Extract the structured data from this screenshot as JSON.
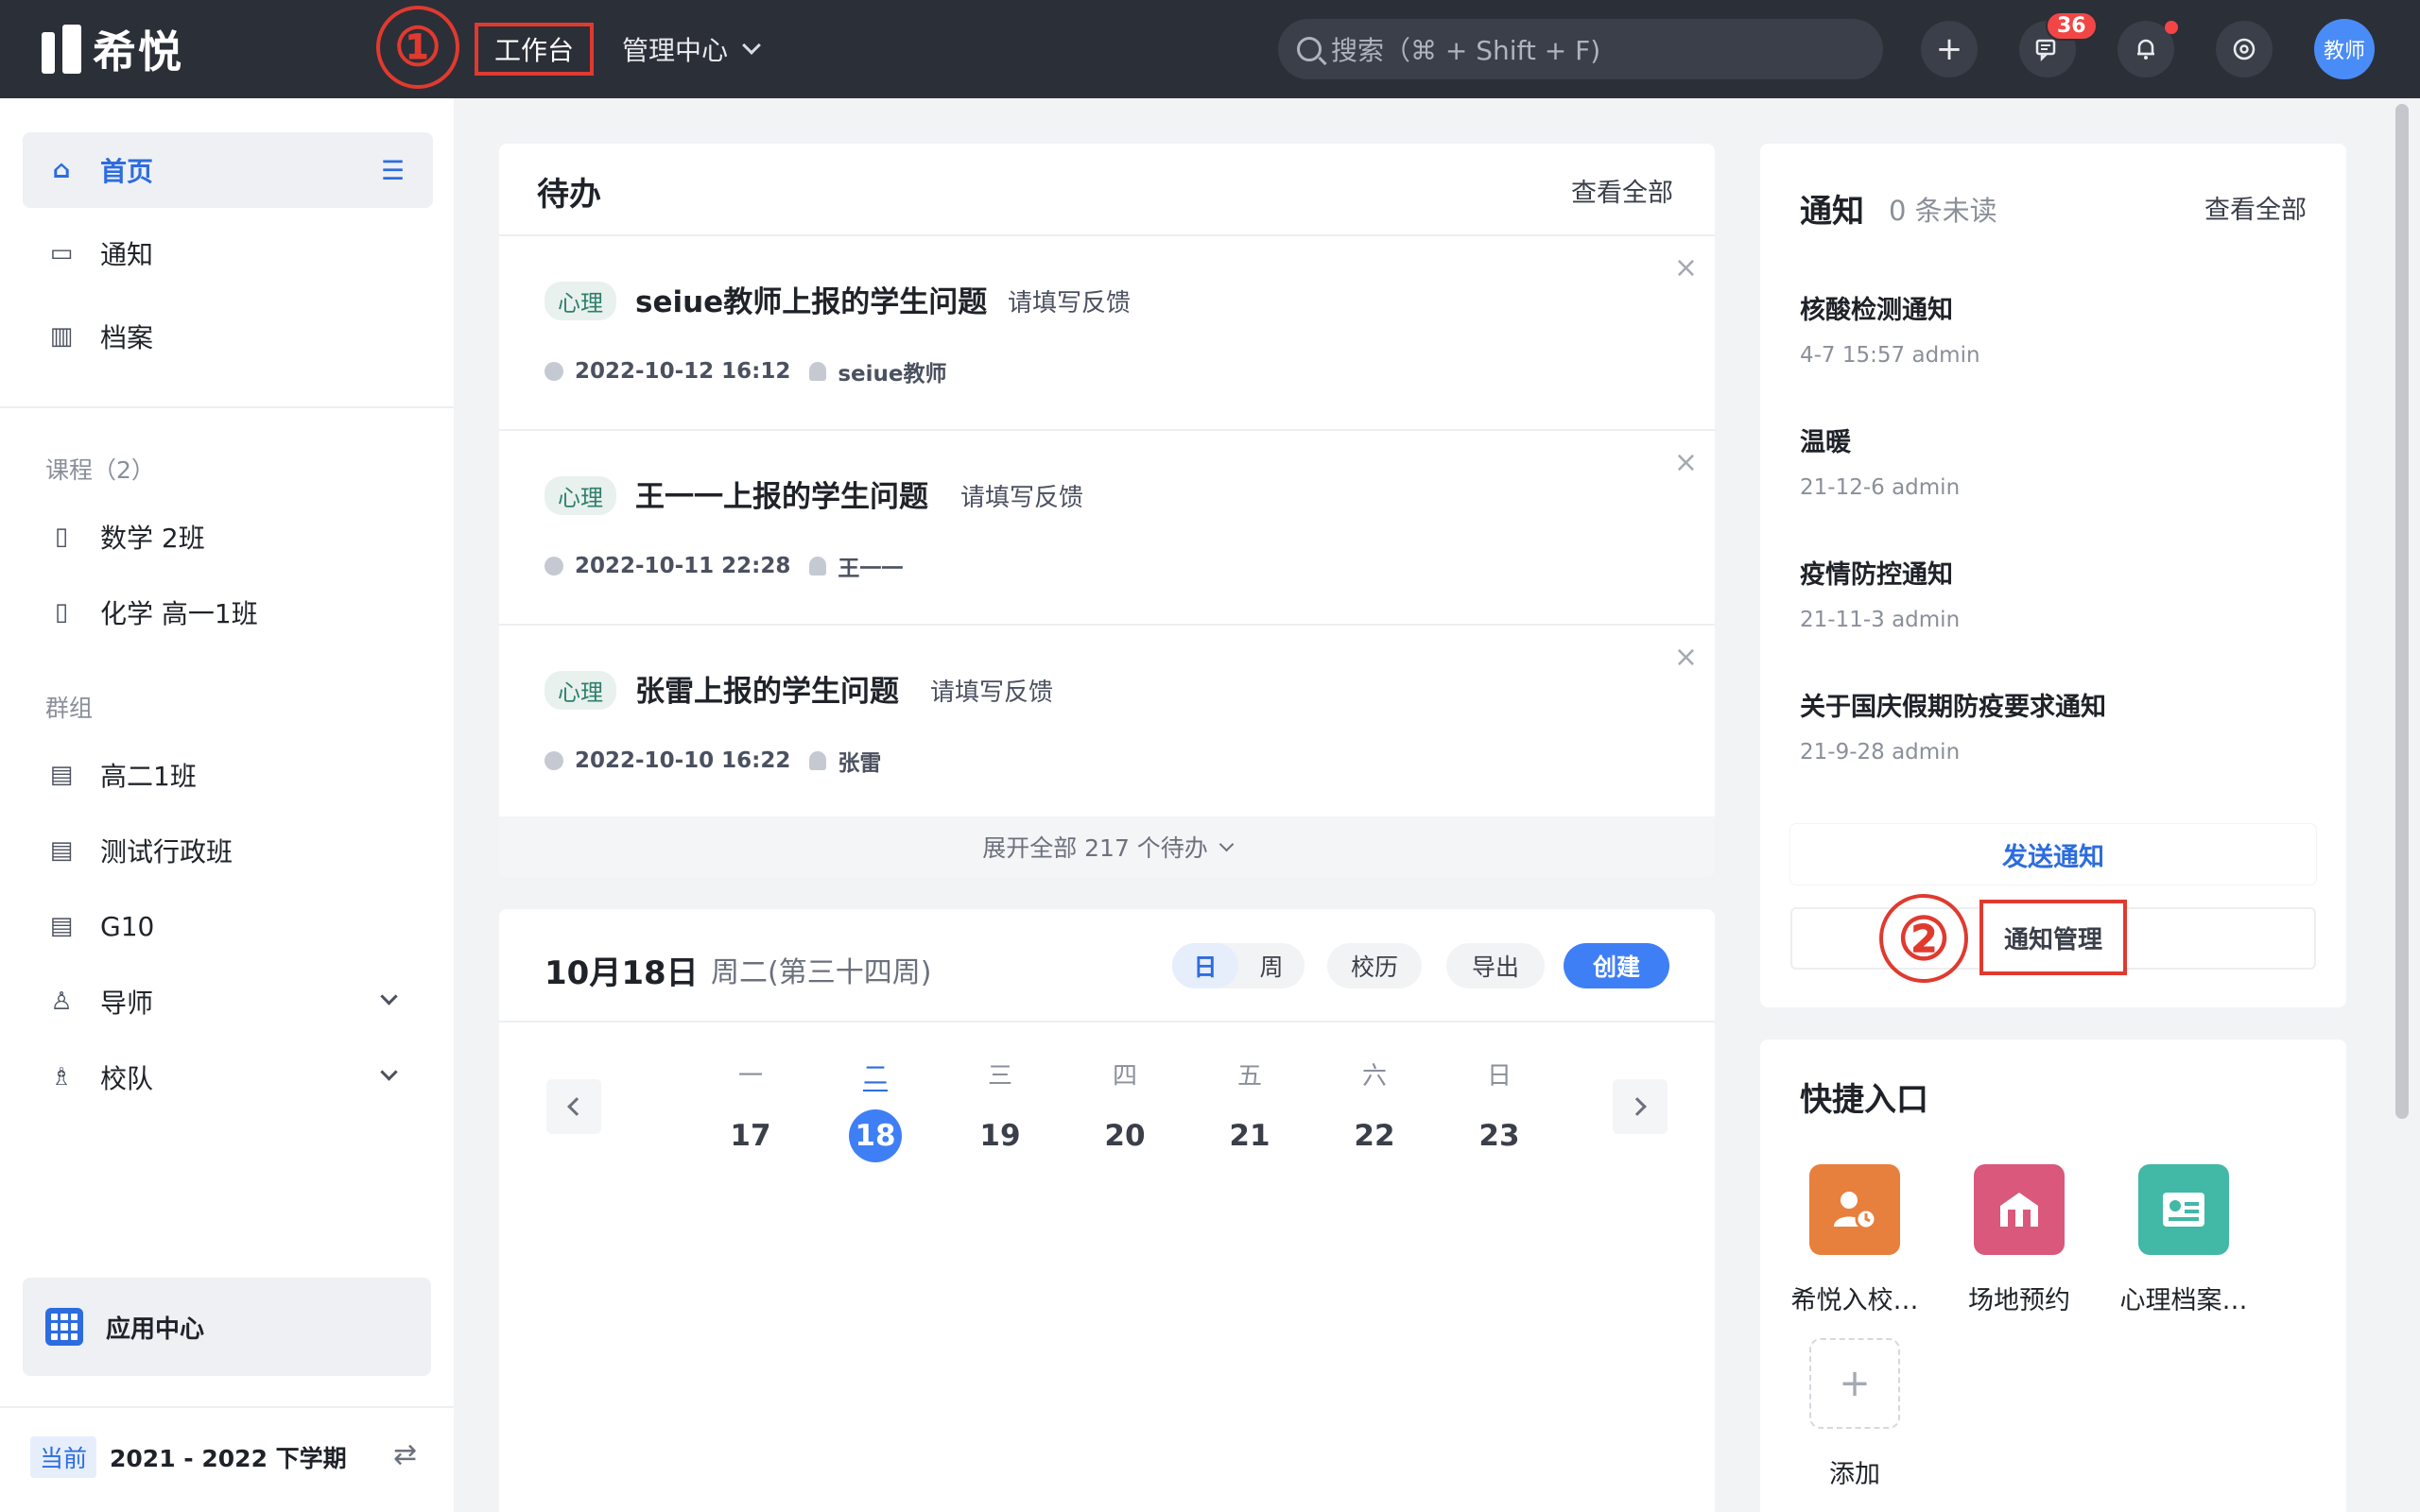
{
  "header": {
    "logo_text": "希悦",
    "step1": "①",
    "nav_workbench": "工作台",
    "nav_admin": "管理中心",
    "search_placeholder": "搜索（⌘ + Shift + F)",
    "message_badge": "36",
    "avatar_label": "教师",
    "icons": [
      "plus-icon",
      "message-icon",
      "bell-icon",
      "settings-icon"
    ]
  },
  "sidebar": {
    "home": "首页",
    "notice": "通知",
    "archive": "档案",
    "course_header": "课程（2）",
    "courses": [
      "数学 2班",
      "化学 高一1班"
    ],
    "group_header": "群组",
    "groups": [
      "高二1班",
      "测试行政班",
      "G10"
    ],
    "mentor": "导师",
    "team": "校队",
    "app_center": "应用中心",
    "term_current": "当前",
    "term_name": "2021 - 2022 下学期"
  },
  "todo": {
    "title": "待办",
    "view_all": "查看全部",
    "items": [
      {
        "tag": "心理",
        "title": "seiue教师上报的学生问题",
        "action": "请填写反馈",
        "time": "2022-10-12 16:12",
        "user": "seiue教师"
      },
      {
        "tag": "心理",
        "title": "王一一上报的学生问题",
        "action": "请填写反馈",
        "time": "2022-10-11 22:28",
        "user": "王一一"
      },
      {
        "tag": "心理",
        "title": "张雷上报的学生问题",
        "action": "请填写反馈",
        "time": "2022-10-10 16:22",
        "user": "张雷"
      }
    ],
    "expand": "展开全部 217 个待办"
  },
  "calendar": {
    "date": "10月18日",
    "week": "周二(第三十四周)",
    "seg_day": "日",
    "seg_week": "周",
    "school_calendar": "校历",
    "export": "导出",
    "create": "创建",
    "days": [
      {
        "wd": "一",
        "dn": "17"
      },
      {
        "wd": "二",
        "dn": "18"
      },
      {
        "wd": "三",
        "dn": "19"
      },
      {
        "wd": "四",
        "dn": "20"
      },
      {
        "wd": "五",
        "dn": "21"
      },
      {
        "wd": "六",
        "dn": "22"
      },
      {
        "wd": "日",
        "dn": "23"
      }
    ]
  },
  "notices": {
    "title": "通知",
    "unread": "0 条未读",
    "view_all": "查看全部",
    "items": [
      {
        "title": "核酸检测通知",
        "meta": "4-7 15:57  admin"
      },
      {
        "title": "温暖",
        "meta": "21-12-6  admin"
      },
      {
        "title": "疫情防控通知",
        "meta": "21-11-3  admin"
      },
      {
        "title": "关于国庆假期防疫要求通知",
        "meta": "21-9-28  admin"
      }
    ],
    "send": "发送通知",
    "manage": "通知管理",
    "step2": "②"
  },
  "quick": {
    "title": "快捷入口",
    "items": [
      {
        "label": "希悦入校…",
        "color": "#e8803d"
      },
      {
        "label": "场地预约",
        "color": "#d9587c"
      },
      {
        "label": "心理档案…",
        "color": "#42b8a6"
      }
    ],
    "add": "添加"
  }
}
